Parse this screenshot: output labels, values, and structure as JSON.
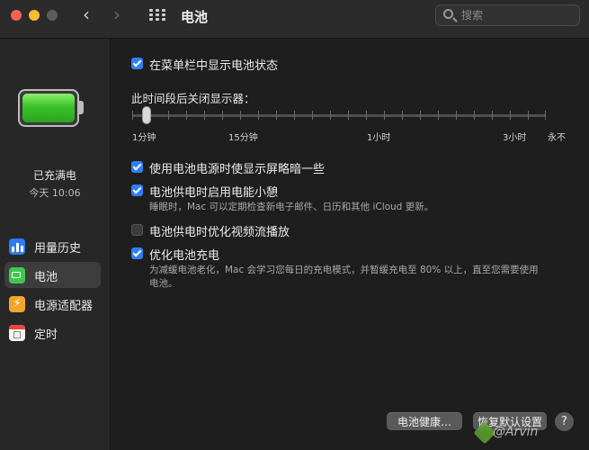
{
  "window": {
    "title": "电池",
    "search_placeholder": "搜索"
  },
  "sidebar": {
    "charge_status": "已充满电",
    "charge_time": "今天 10:06",
    "items": [
      {
        "label": "用量历史",
        "icon": "chart-icon",
        "active": false
      },
      {
        "label": "电池",
        "icon": "battery-icon",
        "active": true
      },
      {
        "label": "电源适配器",
        "icon": "lightning-icon",
        "active": false
      },
      {
        "label": "定时",
        "icon": "calendar-icon",
        "active": false
      }
    ]
  },
  "main": {
    "show_in_menubar": {
      "label": "在菜单栏中显示电池状态",
      "checked": true
    },
    "display_off": {
      "label": "此时间段后关闭显示器：",
      "slider_labels": [
        "1分钟",
        "15分钟",
        "1小时",
        "3小时",
        "永不"
      ],
      "value": "1分钟"
    },
    "dim_display": {
      "label": "使用电池电源时使显示屏略暗一些",
      "checked": true
    },
    "power_nap": {
      "label": "电池供电时启用电能小憩",
      "checked": true,
      "description": "睡眠时，Mac 可以定期检查新电子邮件、日历和其他 iCloud 更新。"
    },
    "optimize_video": {
      "label": "电池供电时优化视频流播放",
      "checked": false
    },
    "optimized_charging": {
      "label": "优化电池充电",
      "checked": true,
      "description_line1": "为减缓电池老化，Mac 会学习您每日的充电模式，并暂缓充电至 80% 以上，直至您需要使用",
      "description_line2": "电池。"
    }
  },
  "footer": {
    "battery_health_button": "电池健康…",
    "restore_defaults_button": "恢复默认设置",
    "help_button": "?",
    "watermark": "@Arvin"
  },
  "colors": {
    "accent": "#2f7ff6",
    "battery_fill": "#3cc22a"
  }
}
